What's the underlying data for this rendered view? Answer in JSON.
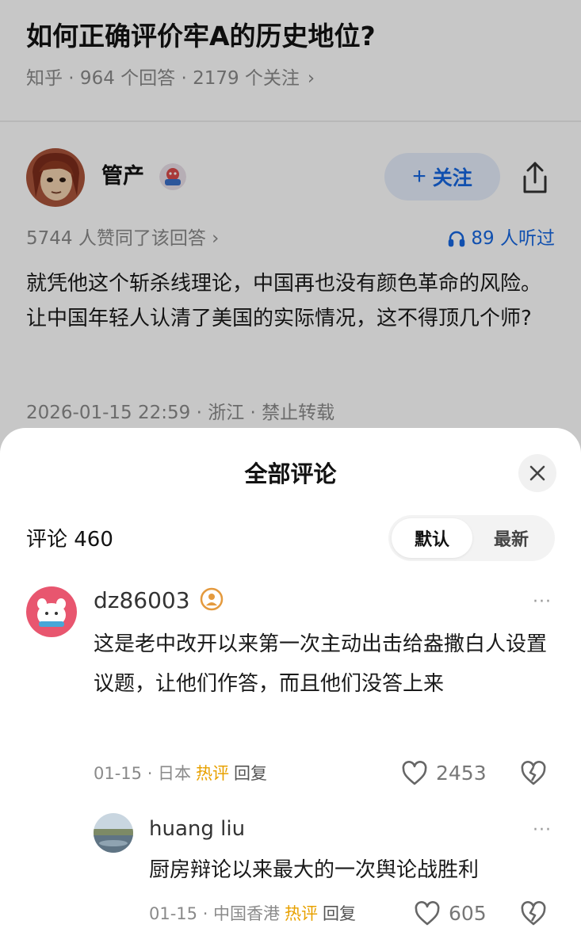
{
  "question": {
    "title": "如何正确评价牢A的历史地位?",
    "meta": "知乎 · 964 个回答 · 2179 个关注",
    "meta_chevron": "›"
  },
  "answer": {
    "author_name": "管产",
    "follow_label": "关注",
    "follow_plus": "+",
    "votes_text": "5744 人赞同了该回答 ›",
    "listen_text": "89 人听过",
    "body": "就凭他这个斩杀线理论，中国再也没有颜色革命的风险。让中国年轻人认清了美国的实际情况，这不得顶几个师?",
    "meta": "2026-01-15 22:59 · 浙江 · 禁止转载"
  },
  "comments_sheet": {
    "title": "全部评论",
    "count_label": "评论 460",
    "sort_options": [
      "默认",
      "最新"
    ],
    "selected_sort": "默认",
    "more_label": "···",
    "comments": [
      {
        "user": "dz86003",
        "text": "这是老中改开以来第一次主动出击给盎撒白人设置议题，让他们作答，而且他们没答上来",
        "date_location": "01-15 · 日本",
        "hot_label": "热评",
        "reply_label": "回复",
        "likes": "2453"
      },
      {
        "user": "huang liu",
        "text": "厨房辩论以来最大的一次舆论战胜利",
        "date_location": "01-15 · 中国香港",
        "hot_label": "热评",
        "reply_label": "回复",
        "likes": "605"
      }
    ]
  },
  "colors": {
    "accent_blue": "#1767e0",
    "hot_orange": "#e8a100",
    "follow_bg": "#e6eefb"
  },
  "icons": [
    "share-icon",
    "headphones-icon",
    "close-icon",
    "heart-icon",
    "dislike-heart-icon",
    "more-icon",
    "verified-badge-icon"
  ]
}
